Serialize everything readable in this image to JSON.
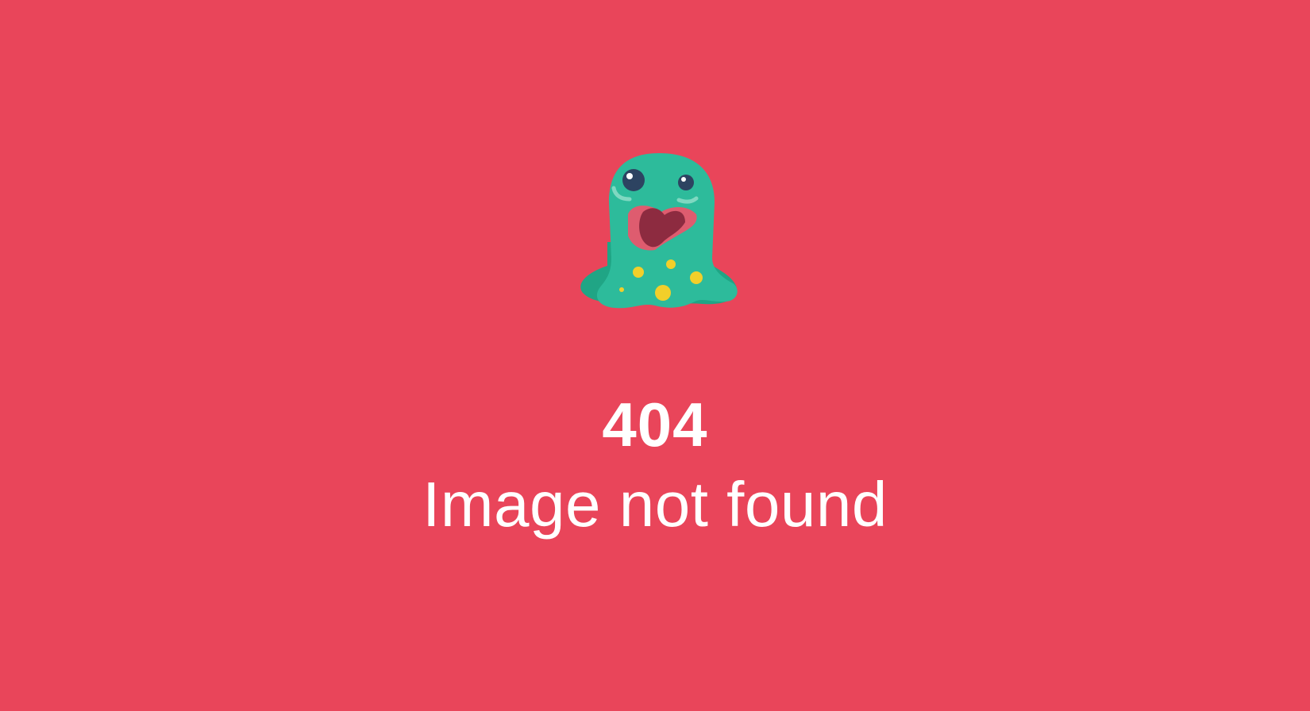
{
  "error": {
    "code": "404",
    "message": "Image not found"
  },
  "illustration": {
    "icon": "slime-monster-icon"
  },
  "colors": {
    "background": "#e9455a",
    "text": "#ffffff",
    "monster_body": "#2dbb9b",
    "monster_shadow": "#20a585",
    "monster_spots": "#f2cf2a",
    "monster_mouth": "#8d2b40",
    "monster_tongue": "#de5c6f",
    "monster_eyes": "#2d4361"
  }
}
